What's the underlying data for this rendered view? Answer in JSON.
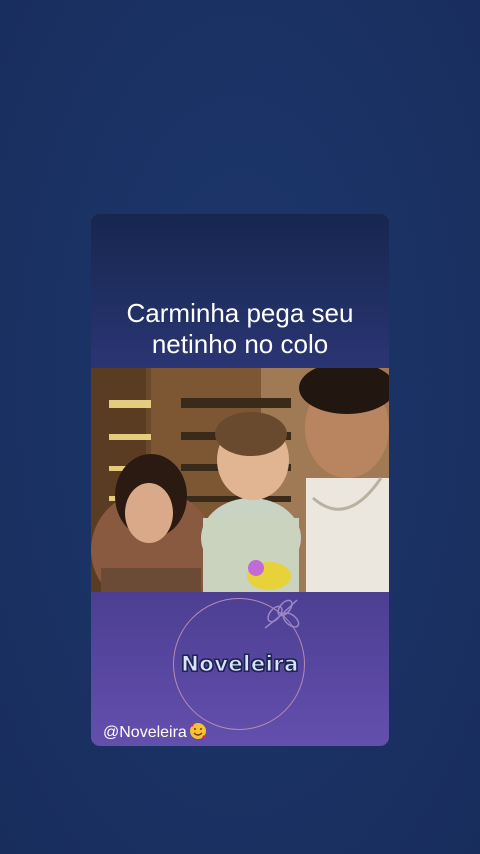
{
  "post": {
    "caption": "Carminha pega seu\nnetinho no colo",
    "logo_text": "Noveleira",
    "handle": "@Noveleira",
    "handle_emoji_icon": "smiling-face-with-hearts-icon"
  },
  "colors": {
    "background": "#1b3366",
    "caption_text": "#ffffff",
    "logo_ring": "#b58bb0",
    "bottom_panel": "#5a48a3"
  }
}
